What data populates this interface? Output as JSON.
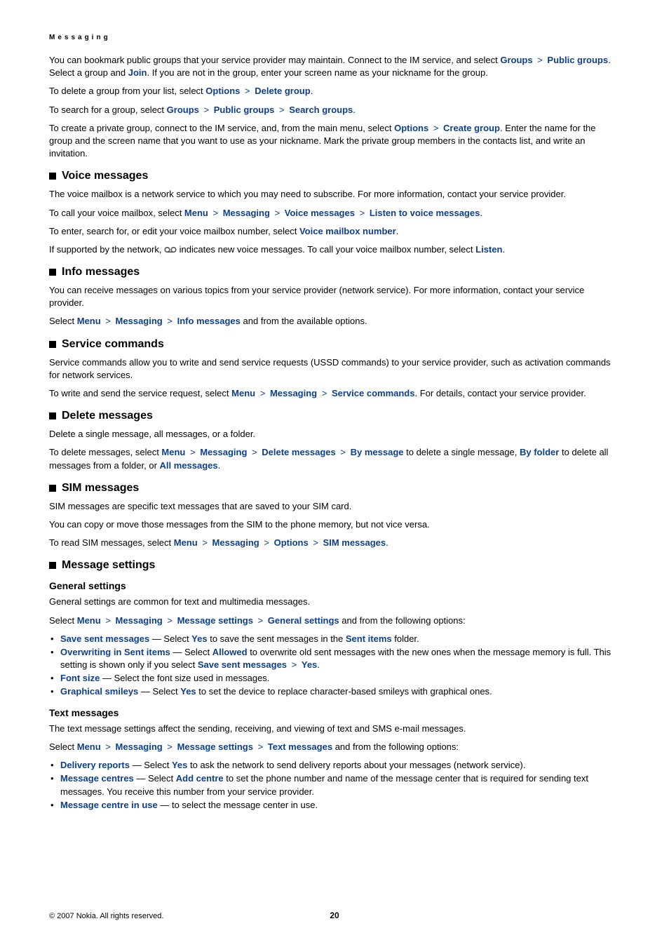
{
  "header": "Messaging",
  "intro": {
    "p1a": "You can bookmark public groups that your service provider may maintain. Connect to the IM service, and select ",
    "groups": "Groups",
    "publicGroups": "Public groups",
    "p1b": ". Select a group and ",
    "join": "Join",
    "p1c": ". If you are not in the group, enter your screen name as your nickname for the group.",
    "p2a": "To delete a group from your list, select ",
    "options": "Options",
    "deleteGroup": "Delete group",
    "p3a": "To search for a group, select ",
    "searchGroups": "Search groups",
    "p4a": "To create a private group, connect to the IM service, and, from the main menu, select ",
    "createGroup": "Create group",
    "p4b": ". Enter the name for the group and the screen name that you want to use as your nickname. Mark the private group members in the contacts list, and write an invitation."
  },
  "voice": {
    "title": "Voice messages",
    "p1": "The voice mailbox is a network service to which you may need to subscribe. For more information, contact your service provider.",
    "p2a": "To call your voice mailbox, select ",
    "menu": "Menu",
    "messaging": "Messaging",
    "voiceMessages": "Voice messages",
    "listenTo": "Listen to voice messages",
    "p3a": "To enter, search for, or edit your voice mailbox number, select ",
    "voiceMailboxNumber": "Voice mailbox number",
    "p4a": "If supported by the network, ",
    "p4b": " indicates new voice messages. To call your voice mailbox number, select ",
    "listen": "Listen"
  },
  "info": {
    "title": "Info messages",
    "p1": "You can receive messages on various topics from your service provider (network service). For more information, contact your service provider.",
    "p2a": "Select ",
    "infoMessages": "Info messages",
    "p2b": " and from the available options."
  },
  "service": {
    "title": "Service commands",
    "p1": "Service commands allow you to write and send service requests (USSD commands) to your service provider, such as activation commands for network services.",
    "p2a": "To write and send the service request, select ",
    "serviceCommands": "Service commands",
    "p2b": ". For details, contact your service provider."
  },
  "delete": {
    "title": "Delete messages",
    "p1": "Delete a single message, all messages, or a folder.",
    "p2a": "To delete messages, select ",
    "deleteMessages": "Delete messages",
    "byMessage": "By message",
    "p2b": " to delete a single message, ",
    "byFolder": "By folder",
    "p2c": " to delete all messages from a folder, or ",
    "allMessages": "All messages"
  },
  "sim": {
    "title": "SIM messages",
    "p1": "SIM messages are specific text messages that are saved to your SIM card.",
    "p2": "You can copy or move those messages from the SIM to the phone memory, but not vice versa.",
    "p3a": "To read SIM messages, select ",
    "optionsLbl": "Options",
    "simMessages": "SIM messages"
  },
  "settings": {
    "title": "Message settings",
    "general": {
      "title": "General settings",
      "p1": "General settings are common for text and multimedia messages.",
      "p2a": "Select ",
      "messageSettings": "Message settings",
      "generalSettings": "General settings",
      "p2b": " and from the following options:",
      "saveSentLabel": "Save sent messages",
      "saveSentRest": " — Select ",
      "yes": "Yes",
      "saveSentRest2": " to save the sent messages in the ",
      "sentItems": "Sent items",
      "saveSentRest3": " folder.",
      "overwritingLabel": "Overwriting in Sent items",
      "overwritingRest1": " — Select ",
      "allowed": "Allowed",
      "overwritingRest2": " to overwrite old sent messages with the new ones when the message memory is full. This setting is shown only if you select ",
      "fontSizeLabel": "Font size",
      "fontSizeRest": " — Select the font size used in messages.",
      "graphicalLabel": "Graphical smileys",
      "graphicalRest": " — Select ",
      "graphicalRest2": " to set the device to replace character-based smileys with graphical ones."
    },
    "text": {
      "title": "Text messages",
      "p1": "The text message settings affect the sending, receiving, and viewing of text and SMS e-mail messages.",
      "p2a": "Select ",
      "textMessages": "Text messages",
      "p2b": " and from the following options:",
      "deliveryLabel": "Delivery reports",
      "deliveryRest1": " — Select ",
      "deliveryRest2": " to ask the network to send delivery reports about your messages (network service).",
      "centresLabel": "Message centres",
      "centresRest1": " — Select ",
      "addCentre": "Add centre",
      "centresRest2": " to set the phone number and name of the message center that is required for sending text messages. You receive this number from your service provider.",
      "inUseLabel": "Message centre in use",
      "inUseRest": " —  to select the message center in use."
    }
  },
  "footer": "© 2007 Nokia. All rights reserved.",
  "pageNo": "20"
}
